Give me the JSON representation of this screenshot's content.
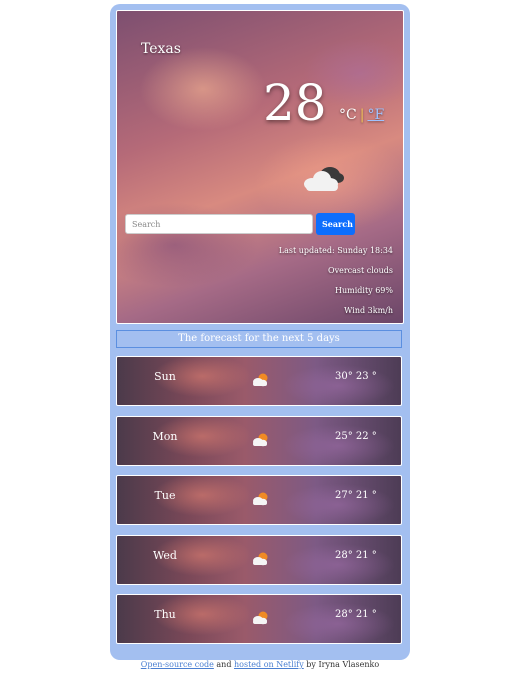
{
  "current": {
    "city": "Texas",
    "temperature": "28",
    "unit_c": "°C",
    "unit_sep": "|",
    "unit_f": "°F",
    "icon": "cloudy-icon",
    "search": {
      "placeholder": "Search",
      "button_label": "Search"
    },
    "last_updated": "Last updated: Sunday 18:34",
    "description": "Overcast clouds",
    "humidity": "Humidity 69%",
    "wind": "Wind 3km/h"
  },
  "forecast": {
    "title": "The forecast for the next 5 days",
    "days": [
      {
        "day": "Sun",
        "temps": "30° 23 °",
        "icon": "partly-cloudy-icon"
      },
      {
        "day": "Mon",
        "temps": "25° 22 °",
        "icon": "partly-cloudy-icon"
      },
      {
        "day": "Tue",
        "temps": "27° 21 °",
        "icon": "partly-cloudy-icon"
      },
      {
        "day": "Wed",
        "temps": "28° 21 °",
        "icon": "partly-cloudy-icon"
      },
      {
        "day": "Thu",
        "temps": "28° 21 °",
        "icon": "partly-cloudy-icon"
      }
    ]
  },
  "footer": {
    "source_link": "Open-source code",
    "and_text": " and ",
    "netlify_link": "hosted on Netlify",
    "by_text": " by Iryna Vlasenko"
  }
}
